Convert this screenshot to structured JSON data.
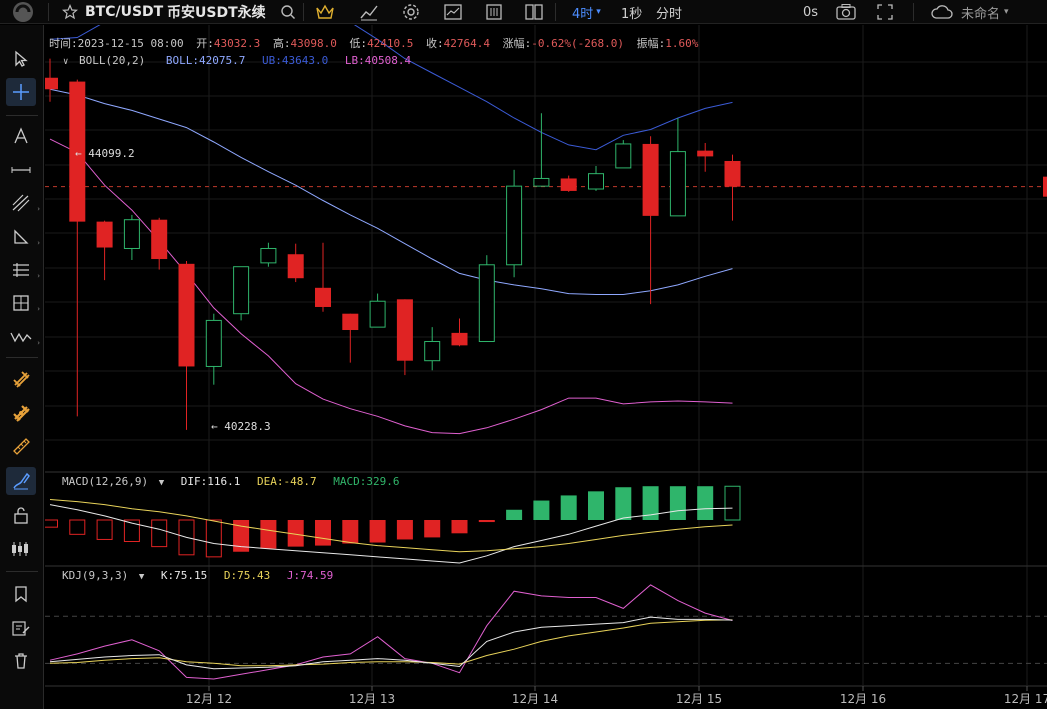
{
  "topbar": {
    "symbol": "BTC/USDT",
    "exchange_name": "币安USDT永续",
    "intervals": [
      {
        "label": "4时",
        "active": true
      },
      {
        "label": "1秒",
        "active": false
      },
      {
        "label": "分时",
        "active": false
      }
    ],
    "countdown": "0s",
    "layout_name": "未命名"
  },
  "ohlc": {
    "time_label": "时间:",
    "time": "2023-12-15 08:00",
    "open_label": "开:",
    "open": "43032.3",
    "high_label": "高:",
    "high": "43098.0",
    "low_label": "低:",
    "low": "42410.5",
    "close_label": "收:",
    "close": "42764.4",
    "change_label": "涨幅:",
    "change": "-0.62%(-268.0)",
    "amp_label": "振幅:",
    "amp": "1.60%"
  },
  "boll": {
    "name": "BOLL(20,2)",
    "mid": "BOLL:42075.7",
    "upper": "UB:43643.0",
    "lower": "LB:40508.4"
  },
  "macd": {
    "name": "MACD(12,26,9)",
    "dif": "DIF:116.1",
    "dea": "DEA:-48.7",
    "macd": "MACD:329.6"
  },
  "kdj": {
    "name": "KDJ(9,3,3)",
    "k": "K:75.15",
    "d": "D:75.43",
    "j": "J:74.59"
  },
  "annotations": {
    "high_marker": "44099.2",
    "low_marker": "40228.3"
  },
  "x_axis": [
    "12月 12",
    "12月 13",
    "12月 14",
    "12月 15",
    "12月 16",
    "12月 17"
  ],
  "colors": {
    "up": "#2fb56b",
    "down": "#e02323",
    "boll_mid": "#8fa8ff",
    "boll_upper": "#3b5bd6",
    "boll_lower": "#e060d0",
    "dif": "#e8e8e8",
    "dea": "#e8d35a",
    "accent": "#4c8dff"
  },
  "chart_data": {
    "type": "candlestick",
    "price_range": [
      39800,
      44450
    ],
    "candles": [
      {
        "o": 43900,
        "h": 44099.2,
        "l": 43650,
        "c": 43780
      },
      {
        "o": 43860,
        "h": 43880,
        "l": 40370,
        "c": 42400
      },
      {
        "o": 42400,
        "h": 42410,
        "l": 41790,
        "c": 42130
      },
      {
        "o": 42120,
        "h": 42470,
        "l": 42000,
        "c": 42420
      },
      {
        "o": 42420,
        "h": 42440,
        "l": 41900,
        "c": 42010
      },
      {
        "o": 41960,
        "h": 41990,
        "l": 40228.3,
        "c": 40890
      },
      {
        "o": 40890,
        "h": 41440,
        "l": 40700,
        "c": 41370
      },
      {
        "o": 41440,
        "h": 41830,
        "l": 41370,
        "c": 41930
      },
      {
        "o": 41970,
        "h": 42180,
        "l": 41930,
        "c": 42120
      },
      {
        "o": 42060,
        "h": 42170,
        "l": 41770,
        "c": 41810
      },
      {
        "o": 41710,
        "h": 42180,
        "l": 41460,
        "c": 41510
      },
      {
        "o": 41440,
        "h": 41440,
        "l": 40930,
        "c": 41270
      },
      {
        "o": 41300,
        "h": 41650,
        "l": 41300,
        "c": 41570
      },
      {
        "o": 41590,
        "h": 41590,
        "l": 40800,
        "c": 40950
      },
      {
        "o": 40950,
        "h": 41300,
        "l": 40850,
        "c": 41150
      },
      {
        "o": 41240,
        "h": 41390,
        "l": 41100,
        "c": 41110
      },
      {
        "o": 41150,
        "h": 42050,
        "l": 41150,
        "c": 41950
      },
      {
        "o": 41950,
        "h": 42940,
        "l": 41820,
        "c": 42770
      },
      {
        "o": 42770,
        "h": 43530,
        "l": 42770,
        "c": 42850
      },
      {
        "o": 42850,
        "h": 42880,
        "l": 42710,
        "c": 42720
      },
      {
        "o": 42740,
        "h": 42980,
        "l": 42720,
        "c": 42900
      },
      {
        "o": 42960,
        "h": 43250,
        "l": 42960,
        "c": 43210
      },
      {
        "o": 43210,
        "h": 43290,
        "l": 41540,
        "c": 42460
      },
      {
        "o": 42460,
        "h": 43480,
        "l": 42460,
        "c": 43130
      },
      {
        "o": 43140,
        "h": 43220,
        "l": 42920,
        "c": 43080
      },
      {
        "o": 43032.3,
        "h": 43098.0,
        "l": 42410.5,
        "c": 42764.4
      }
    ],
    "boll_upper": [
      44300,
      44320,
      44480,
      44600,
      44740,
      44900,
      44960,
      44920,
      44880,
      44860,
      44700,
      44480,
      44300,
      44100,
      43950,
      43800,
      43650,
      43480,
      43330,
      43200,
      43150,
      43300,
      43360,
      43480,
      43580,
      43643.0
    ],
    "boll_mid": [
      43780,
      43720,
      43630,
      43560,
      43470,
      43380,
      43230,
      43070,
      42920,
      42780,
      42620,
      42470,
      42330,
      42170,
      42010,
      41860,
      41790,
      41740,
      41700,
      41650,
      41640,
      41640,
      41680,
      41740,
      41830,
      41910
    ],
    "boll_lower": [
      43260,
      43120,
      42780,
      42520,
      42200,
      41860,
      41500,
      41230,
      41000,
      40710,
      40550,
      40450,
      40370,
      40270,
      40200,
      40190,
      40250,
      40340,
      40440,
      40560,
      40560,
      40500,
      40520,
      40530,
      40520,
      40508.4
    ],
    "macd_dif": [
      150,
      100,
      40,
      -30,
      -90,
      -170,
      -230,
      -260,
      -280,
      -300,
      -320,
      -340,
      -360,
      -380,
      -400,
      -420,
      -350,
      -260,
      -200,
      -140,
      -60,
      20,
      50,
      90,
      110,
      116.1
    ],
    "macd_dea": [
      200,
      180,
      150,
      110,
      80,
      40,
      -10,
      -60,
      -100,
      -140,
      -180,
      -220,
      -250,
      -270,
      -290,
      -310,
      -300,
      -280,
      -260,
      -230,
      -190,
      -150,
      -120,
      -90,
      -65,
      -48.7
    ],
    "macd_hist": [
      -70,
      -140,
      -190,
      -210,
      -260,
      -340,
      -360,
      -310,
      -280,
      -260,
      -250,
      -230,
      -220,
      -190,
      -170,
      -130,
      -20,
      100,
      190,
      240,
      280,
      320,
      330,
      330,
      330,
      329.6
    ],
    "kdj_k": [
      22,
      25,
      28,
      30,
      31,
      18,
      13,
      14,
      15,
      17,
      22,
      24,
      26,
      24,
      20,
      16,
      48,
      60,
      66,
      68,
      70,
      72,
      79,
      76,
      76,
      75.15
    ],
    "kdj_d": [
      20,
      21,
      24,
      26,
      27,
      22,
      20,
      17,
      17,
      18,
      19,
      21,
      22,
      22,
      21,
      19,
      30,
      38,
      48,
      55,
      60,
      65,
      71,
      73,
      75,
      75.43
    ],
    "kdj_j": [
      24,
      32,
      42,
      50,
      36,
      2,
      0,
      6,
      12,
      18,
      28,
      32,
      54,
      26,
      20,
      8,
      68,
      112,
      106,
      104,
      104,
      90,
      120,
      100,
      84,
      74.59
    ]
  }
}
